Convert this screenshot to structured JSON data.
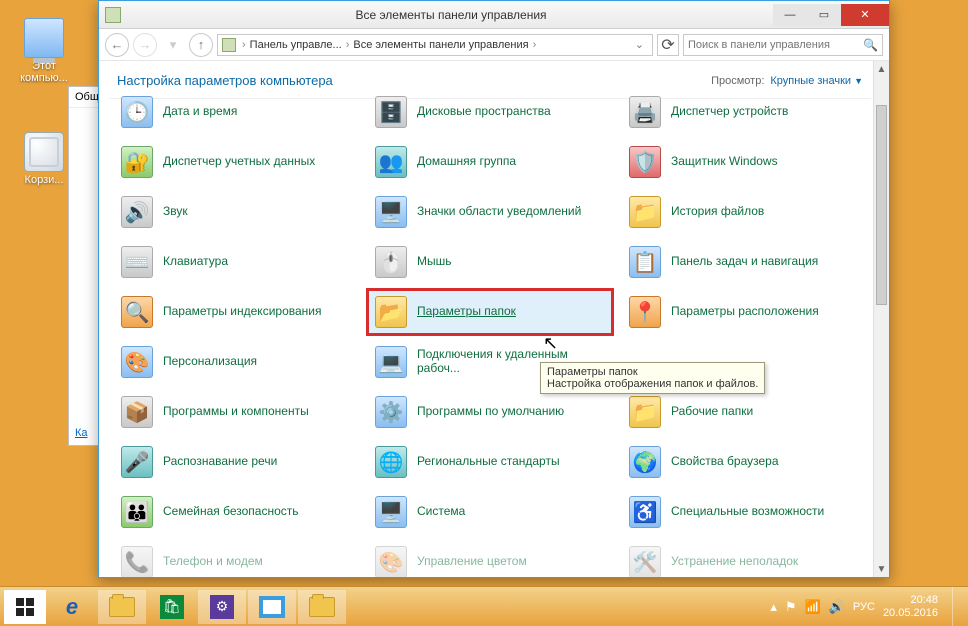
{
  "desktop": {
    "icon_computer": "Этот компью...",
    "icon_bin": "Корзи..."
  },
  "bgwin": {
    "tab": "Общ",
    "link": "Ка"
  },
  "window": {
    "title": "Все элементы панели управления",
    "breadcrumb": {
      "level1": "Панель управле...",
      "level2": "Все элементы панели управления"
    },
    "search_placeholder": "Поиск в панели управления",
    "heading": "Настройка параметров компьютера",
    "view_label": "Просмотр:",
    "view_value": "Крупные значки",
    "items": {
      "0": {
        "label": "Дата и время"
      },
      "1": {
        "label": "Дисковые пространства"
      },
      "2": {
        "label": "Диспетчер устройств"
      },
      "3": {
        "label": "Диспетчер учетных данных"
      },
      "4": {
        "label": "Домашняя группа"
      },
      "5": {
        "label": "Защитник Windows"
      },
      "6": {
        "label": "Звук"
      },
      "7": {
        "label": "Значки области уведомлений"
      },
      "8": {
        "label": "История файлов"
      },
      "9": {
        "label": "Клавиатура"
      },
      "10": {
        "label": "Мышь"
      },
      "11": {
        "label": "Панель задач и навигация"
      },
      "12": {
        "label": "Параметры индексирования"
      },
      "13": {
        "label": "Параметры папок"
      },
      "14": {
        "label": "Параметры расположения"
      },
      "15": {
        "label": "Персонализация"
      },
      "16": {
        "label": "Подключения к удаленным рабоч..."
      },
      "17": {
        "label": "Программы и компоненты"
      },
      "18": {
        "label": "Программы по умолчанию"
      },
      "19": {
        "label": "Рабочие папки"
      },
      "20": {
        "label": "Распознавание речи"
      },
      "21": {
        "label": "Региональные стандарты"
      },
      "22": {
        "label": "Свойства браузера"
      },
      "23": {
        "label": "Семейная безопасность"
      },
      "24": {
        "label": "Система"
      },
      "25": {
        "label": "Специальные возможности"
      },
      "26": {
        "label": "Телефон и модем"
      },
      "27": {
        "label": "Управление цветом"
      },
      "28": {
        "label": "Устранение неполадок"
      }
    }
  },
  "tooltip": {
    "title": "Параметры папок",
    "desc": "Настройка отображения папок и файлов."
  },
  "taskbar": {
    "lang": "РУС",
    "time": "20:48",
    "date": "20.05.2016"
  }
}
